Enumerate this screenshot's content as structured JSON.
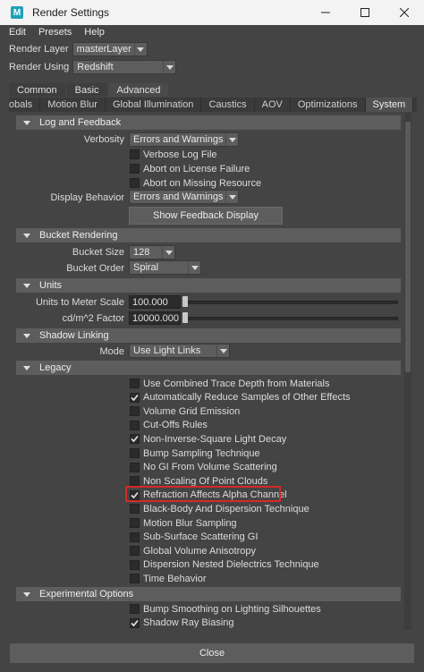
{
  "window": {
    "title": "Render Settings",
    "app_icon_letter": "M"
  },
  "menu": [
    "Edit",
    "Presets",
    "Help"
  ],
  "render_layer": {
    "label": "Render Layer",
    "value": "masterLayer"
  },
  "render_using": {
    "label": "Render Using",
    "value": "Redshift"
  },
  "top_tabs": [
    "Common",
    "Basic",
    "Advanced"
  ],
  "sub_tabs": [
    "Globals",
    "Motion Blur",
    "Global Illumination",
    "Caustics",
    "AOV",
    "Optimizations",
    "System"
  ],
  "sub_tabs_visible": [
    "obals",
    "Motion Blur",
    "Global Illumination",
    "Caustics",
    "AOV",
    "Optimizations",
    "System"
  ],
  "log_feedback": {
    "title": "Log and Feedback",
    "verbosity_label": "Verbosity",
    "verbosity_value": "Errors and Warnings",
    "verbose_log": "Verbose Log File",
    "abort_license": "Abort on License Failure",
    "abort_missing": "Abort on Missing Resource",
    "display_behavior_label": "Display Behavior",
    "display_behavior_value": "Errors and Warnings",
    "show_feedback": "Show Feedback Display"
  },
  "bucket": {
    "title": "Bucket Rendering",
    "size_label": "Bucket Size",
    "size_value": "128",
    "order_label": "Bucket Order",
    "order_value": "Spiral"
  },
  "units": {
    "title": "Units",
    "meter_label": "Units to Meter Scale",
    "meter_value": "100.000",
    "cdm_label": "cd/m^2 Factor",
    "cdm_value": "10000.000"
  },
  "shadow": {
    "title": "Shadow Linking",
    "mode_label": "Mode",
    "mode_value": "Use Light Links"
  },
  "legacy": {
    "title": "Legacy",
    "items": [
      {
        "label": "Use Combined Trace Depth from Materials",
        "checked": false
      },
      {
        "label": "Automatically Reduce Samples of Other Effects",
        "checked": true
      },
      {
        "label": "Volume Grid Emission",
        "checked": false
      },
      {
        "label": "Cut-Offs Rules",
        "checked": false
      },
      {
        "label": "Non-Inverse-Square Light Decay",
        "checked": true
      },
      {
        "label": "Bump Sampling Technique",
        "checked": false
      },
      {
        "label": "No GI From Volume Scattering",
        "checked": false
      },
      {
        "label": "Non Scaling Of Point Clouds",
        "checked": false
      },
      {
        "label": "Refraction Affects Alpha Channel",
        "checked": true
      },
      {
        "label": "Black-Body And Dispersion Technique",
        "checked": false
      },
      {
        "label": "Motion Blur Sampling",
        "checked": false
      },
      {
        "label": "Sub-Surface Scattering GI",
        "checked": false
      },
      {
        "label": "Global Volume Anisotropy",
        "checked": false
      },
      {
        "label": "Dispersion Nested Dielectrics Technique",
        "checked": false
      },
      {
        "label": "Time Behavior",
        "checked": false
      }
    ]
  },
  "experimental": {
    "title": "Experimental Options",
    "items": [
      {
        "label": "Bump Smoothing on Lighting Silhouettes",
        "checked": false
      },
      {
        "label": "Shadow Ray Biasing",
        "checked": true
      }
    ]
  },
  "close_label": "Close",
  "colors": {
    "highlight": "#d12a2a",
    "panel": "#444444",
    "section": "#5d5d5d"
  }
}
